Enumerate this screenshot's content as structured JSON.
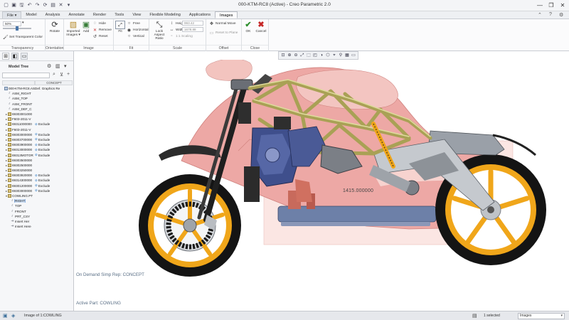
{
  "window": {
    "title": "000-KTM-RC8 (Active) - Creo Parametric 2.0",
    "minimize": "—",
    "restore": "❐",
    "close": "✕"
  },
  "quick_access": [
    "▢",
    "▣",
    "🖫",
    "↶",
    "↷",
    "⟳",
    "▤",
    "✕",
    "▾"
  ],
  "ribbon_tabs": [
    {
      "label": "File ▾",
      "state": "file"
    },
    {
      "label": "Model",
      "state": ""
    },
    {
      "label": "Analysis",
      "state": ""
    },
    {
      "label": "Annotate",
      "state": ""
    },
    {
      "label": "Render",
      "state": ""
    },
    {
      "label": "Tools",
      "state": ""
    },
    {
      "label": "View",
      "state": ""
    },
    {
      "label": "Flexible Modeling",
      "state": ""
    },
    {
      "label": "Applications",
      "state": ""
    },
    {
      "label": "Images",
      "state": "active"
    }
  ],
  "ribbon": {
    "transparency": {
      "value": "50%",
      "set_color": "Set Transparent Color",
      "label": "Transparency"
    },
    "orientation": {
      "rotate": "Rotate",
      "label": "Orientation"
    },
    "image": {
      "imported_images": "Imported Images ▾",
      "add": "Add",
      "hide": "Hide",
      "remove": "Remove",
      "reset": "Reset",
      "label": "Image"
    },
    "fit": {
      "fit": "Fit",
      "free": "Free",
      "horizontal": "Horizontal",
      "vertical": "Vertical",
      "label": "Fit"
    },
    "scale": {
      "lock_aspect": "Lock Aspect Ratio",
      "height_label": "Height",
      "height_value": "993.42",
      "width_label": "Width",
      "width_value": "1678.88",
      "one_to_one": "1:1 Scaling",
      "label": "Scale"
    },
    "offset": {
      "normal_move": "Normal Move",
      "reset_to_plane": "Reset to Plane",
      "label": "Offset"
    },
    "close": {
      "ok": "OK",
      "cancel": "Cancel",
      "label": "Close"
    }
  },
  "model_tree": {
    "title": "Model Tree",
    "column_name": "",
    "column_simp_rep": "CONCEPT",
    "rows": [
      {
        "name": "000-KTM-RC8.AS",
        "status": "Def. Graphics Re",
        "icon": "asm",
        "expander": "",
        "warn": false,
        "selected": false
      },
      {
        "name": "ASM_RIGHT",
        "status": "",
        "icon": "plane",
        "expander": "",
        "warn": false,
        "selected": false
      },
      {
        "name": "ASM_TOP",
        "status": "",
        "icon": "plane",
        "expander": "",
        "warn": false,
        "selected": false
      },
      {
        "name": "ASM_FRONT",
        "status": "",
        "icon": "plane",
        "expander": "",
        "warn": false,
        "selected": false
      },
      {
        "name": "ASM_DEF_C",
        "status": "",
        "icon": "plane",
        "expander": "",
        "warn": false,
        "selected": false
      },
      {
        "name": "69303001000",
        "status": "",
        "icon": "part",
        "expander": "▸",
        "warn": false,
        "selected": false
      },
      {
        "name": "F603-2011-V",
        "status": "",
        "icon": "part",
        "expander": "▸",
        "warn": false,
        "selected": false
      },
      {
        "name": "69311000000",
        "status": "Exclude",
        "icon": "part",
        "expander": "▸",
        "warn": true,
        "selected": false
      },
      {
        "name": "F603-2011-V",
        "status": "",
        "icon": "part",
        "expander": "▸",
        "warn": false,
        "selected": false
      },
      {
        "name": "69303000000",
        "status": "Exclude",
        "icon": "part",
        "expander": "▸",
        "warn": true,
        "selected": false
      },
      {
        "name": "69303700000",
        "status": "Exclude",
        "icon": "part",
        "expander": "▸",
        "warn": true,
        "selected": false
      },
      {
        "name": "69303900000",
        "status": "Exclude",
        "icon": "part",
        "expander": "▸",
        "warn": true,
        "selected": false
      },
      {
        "name": "69313000000",
        "status": "Exclude",
        "icon": "part",
        "expander": "▸",
        "warn": true,
        "selected": false
      },
      {
        "name": "69313MOTOR",
        "status": "Exclude",
        "icon": "part",
        "expander": "▸",
        "warn": true,
        "selected": false
      },
      {
        "name": "69303500000",
        "status": "",
        "icon": "part",
        "expander": "▸",
        "warn": false,
        "selected": false
      },
      {
        "name": "69302500000",
        "status": "",
        "icon": "part",
        "expander": "▸",
        "warn": false,
        "selected": false
      },
      {
        "name": "69303250000",
        "status": "",
        "icon": "part",
        "expander": "▸",
        "warn": false,
        "selected": false
      },
      {
        "name": "69303920000",
        "status": "Exclude",
        "icon": "part",
        "expander": "▸",
        "warn": true,
        "selected": false
      },
      {
        "name": "69314300000",
        "status": "Exclude",
        "icon": "part",
        "expander": "▸",
        "warn": true,
        "selected": false
      },
      {
        "name": "69301200000",
        "status": "Exclude",
        "icon": "part",
        "expander": "▸",
        "warn": true,
        "selected": false
      },
      {
        "name": "69303000000",
        "status": "Exclude",
        "icon": "part",
        "expander": "▸",
        "warn": true,
        "selected": false
      },
      {
        "name": "COWLING.PT",
        "status": "",
        "icon": "part",
        "expander": "▾",
        "warn": false,
        "selected": false
      },
      {
        "name": "RIGHT",
        "status": "",
        "icon": "plane",
        "expander": "",
        "warn": false,
        "selected": true
      },
      {
        "name": "TOP",
        "status": "",
        "icon": "plane",
        "expander": "",
        "warn": false,
        "selected": false
      },
      {
        "name": "FRONT",
        "status": "",
        "icon": "plane",
        "expander": "",
        "warn": false,
        "selected": false
      },
      {
        "name": "PRT_CSY",
        "status": "",
        "icon": "plane",
        "expander": "",
        "warn": false,
        "selected": false
      },
      {
        "name": "Insert Her",
        "status": "",
        "icon": "insert",
        "expander": "",
        "warn": false,
        "selected": false
      },
      {
        "name": "Insert Here",
        "status": "",
        "icon": "insert",
        "expander": "",
        "warn": false,
        "selected": false
      }
    ]
  },
  "graphics": {
    "dimension_value": "1415.000000",
    "demand_note": "On Demand Simp Rep: CONCEPT",
    "active_part": "Active Part: COWLING",
    "toolbar_icons": [
      "⊡",
      "⊕",
      "⊖",
      "⤢",
      "⬚",
      "◰",
      "◑",
      "⬡",
      "⌖",
      "⚲",
      "▦",
      "▭"
    ]
  },
  "status_bar": {
    "message": "Image of 1:COWLING",
    "selected": "1 selected",
    "filter": "Images"
  },
  "colors": {
    "accent": "#1d6fbf",
    "cowling": "#e8a7a3",
    "frame": "#c9c47c",
    "wheel": "#f0a61a",
    "tire": "#141414"
  }
}
